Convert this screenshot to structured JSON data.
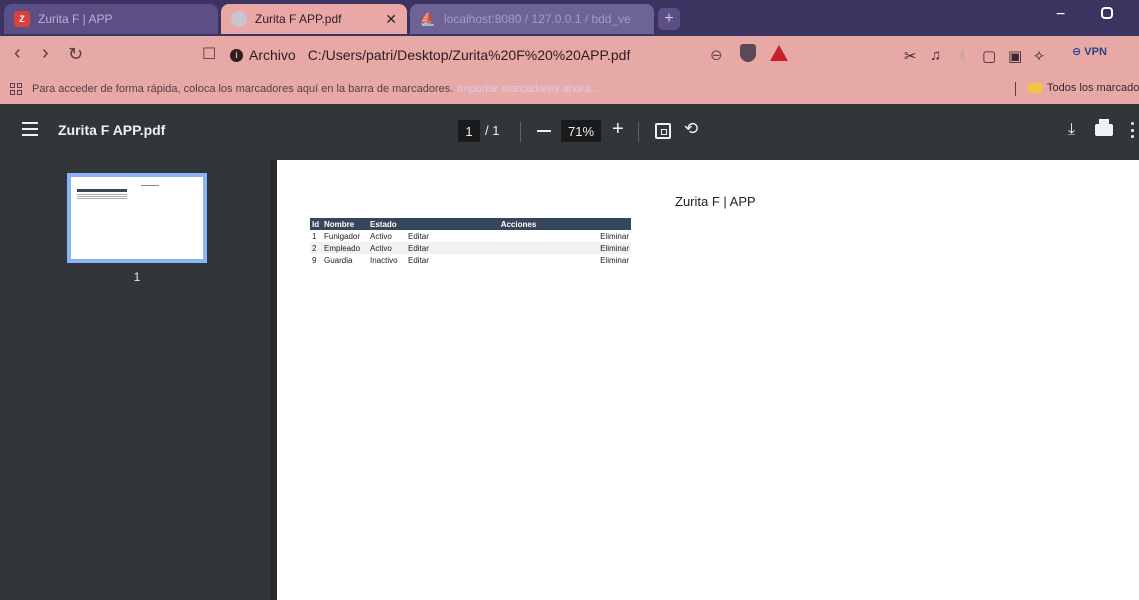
{
  "browser": {
    "tabs": [
      {
        "label": "Zurita F | APP",
        "favicon": "Z"
      },
      {
        "label": "Zurita F APP.pdf",
        "close": "✕"
      },
      {
        "label": "localhost:8080 / 127.0.0.1 / bdd_ve",
        "favicon": "⛵"
      }
    ],
    "new_tab": "+",
    "window_min": "−"
  },
  "toolbar": {
    "back": "‹",
    "forward": "›",
    "reload": "↻",
    "bookmark": "☐",
    "security_label": "Archivo",
    "url": "C:/Users/patri/Desktop/Zurita%20F%20%20APP.pdf",
    "zoom": "⊖",
    "ext_icons": [
      "✂",
      "♫",
      "⬇",
      "▢",
      "▣",
      "⟡"
    ],
    "vpn": "⊖ VPN"
  },
  "bookmarks": {
    "message": "Para acceder de forma rápida, coloca los marcadores aquí en la barra de marcadores.",
    "import_link": "Importar marcadores ahora...",
    "all_label": "Todos los marcado"
  },
  "pdf": {
    "filename": "Zurita F APP.pdf",
    "page_current": "1",
    "page_total": "/ 1",
    "zoom": "71%",
    "zoom_in": "+",
    "rotate": "⟲",
    "download": "⤓",
    "thumbnail_page": "1"
  },
  "document": {
    "title": "Zurita F | APP",
    "columns": [
      "Id",
      "Nombre",
      "Estado",
      "Acciones"
    ],
    "rows": [
      {
        "id": "1",
        "nombre": "Funigador",
        "estado": "Activo",
        "editar": "Editar",
        "eliminar": "Eliminar"
      },
      {
        "id": "2",
        "nombre": "Empleado",
        "estado": "Activo",
        "editar": "Editar",
        "eliminar": "Eliminar"
      },
      {
        "id": "9",
        "nombre": "Guardia",
        "estado": "Inactivo",
        "editar": "Editar",
        "eliminar": "Eliminar"
      }
    ]
  },
  "colors": {
    "tab_strip": "#3b3360",
    "toolbar": "#e6a9a6",
    "pdf_chrome": "#323639",
    "table_header": "#37475a",
    "thumbnail_border": "#8ab4f8"
  }
}
